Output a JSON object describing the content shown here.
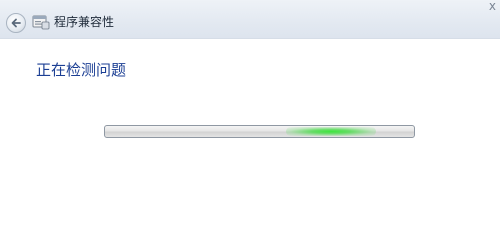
{
  "window": {
    "title": "程序兼容性",
    "close_glyph": "x"
  },
  "main": {
    "heading": "正在检测问题"
  },
  "progress": {
    "mode": "indeterminate-marquee",
    "glow_position_fraction": 0.73,
    "glow_color": "#3ce63c"
  },
  "colors": {
    "heading": "#1c3f94",
    "titlebar": "#e3e9f1"
  },
  "icons": {
    "back": "back-arrow-icon",
    "app": "program-compatibility-icon"
  }
}
